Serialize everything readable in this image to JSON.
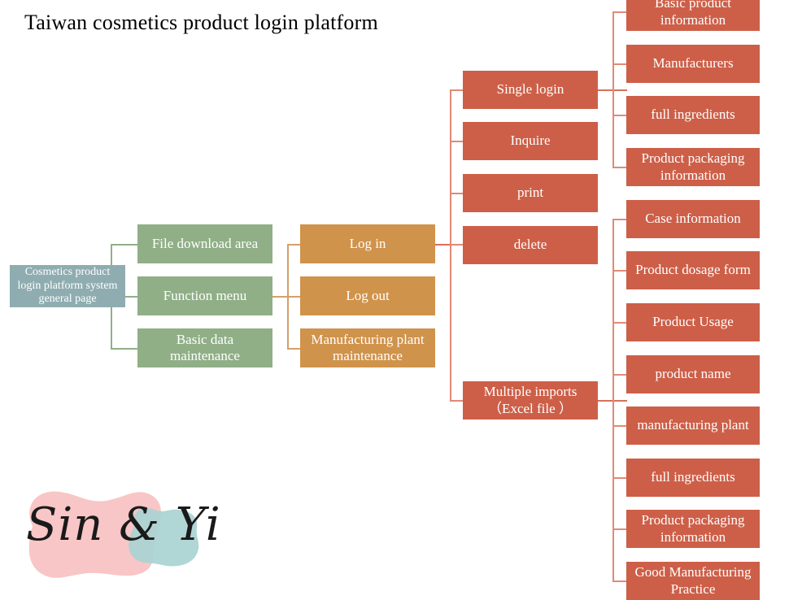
{
  "page": {
    "title": "Taiwan cosmetics product login platform",
    "background_color": "#ffffff"
  },
  "colors": {
    "root": "#8fadb0",
    "level1": "#90af87",
    "level2": "#d0934b",
    "level3": "#cd5f48",
    "connector_green": "#90af87",
    "connector_amber": "#d4a06a",
    "connector_red": "#e08a78",
    "text": "#ffffff",
    "title_text": "#000000",
    "logo_pink": "#f8c6c6",
    "logo_teal": "#a9d3d3"
  },
  "chart_data": {
    "type": "tree-diagram",
    "title": "Taiwan cosmetics product login platform",
    "root": "Cosmetics product  login platform system general page",
    "levels": [
      [
        "File download area",
        "Function menu",
        "Basic data maintenance"
      ],
      [
        "Log in",
        "Log out",
        "Manufacturing plant maintenance"
      ],
      [
        "Single login",
        "Inquire",
        "print",
        "delete",
        "Multiple imports （Excel file）"
      ],
      [
        "Basic product information",
        "Manufacturers",
        "full ingredients",
        "Product packaging information",
        "Case information",
        "Product dosage form",
        "Product Usage",
        "product name",
        "manufacturing plant",
        "full ingredients",
        "Product packaging information",
        "Good Manufacturing Practice"
      ]
    ],
    "edges": [
      {
        "from": "Cosmetics product  login platform system general page",
        "to": "File download area"
      },
      {
        "from": "Cosmetics product  login platform system general page",
        "to": "Function menu"
      },
      {
        "from": "Cosmetics product  login platform system general page",
        "to": "Basic data maintenance"
      },
      {
        "from": "Function menu",
        "to": "Log in"
      },
      {
        "from": "Function menu",
        "to": "Log out"
      },
      {
        "from": "Function menu",
        "to": "Manufacturing plant maintenance"
      },
      {
        "from": "Log in",
        "to": "Single login"
      },
      {
        "from": "Log in",
        "to": "Inquire"
      },
      {
        "from": "Log in",
        "to": "print"
      },
      {
        "from": "Log in",
        "to": "delete"
      },
      {
        "from": "Log in",
        "to": "Multiple imports （Excel file）"
      },
      {
        "from": "Single login",
        "to": "Basic product information"
      },
      {
        "from": "Single login",
        "to": "Manufacturers"
      },
      {
        "from": "Single login",
        "to": "full ingredients"
      },
      {
        "from": "Single login",
        "to": "Product packaging information"
      },
      {
        "from": "Multiple imports （Excel file）",
        "to": "Case information"
      },
      {
        "from": "Multiple imports （Excel file）",
        "to": "Product dosage form"
      },
      {
        "from": "Multiple imports （Excel file）",
        "to": "Product Usage"
      },
      {
        "from": "Multiple imports （Excel file）",
        "to": "product name"
      },
      {
        "from": "Multiple imports （Excel file）",
        "to": "manufacturing plant"
      },
      {
        "from": "Multiple imports （Excel file）",
        "to": "full ingredients"
      },
      {
        "from": "Multiple imports （Excel file）",
        "to": "Product packaging information"
      },
      {
        "from": "Multiple imports （Excel file）",
        "to": "Good Manufacturing Practice"
      }
    ]
  },
  "nodes": {
    "root": {
      "label": "Cosmetics product  login platform system general page"
    },
    "col1": [
      {
        "label": "File download area"
      },
      {
        "label": "Function menu"
      },
      {
        "label": "Basic data maintenance"
      }
    ],
    "col2": [
      {
        "label": "Log in"
      },
      {
        "label": "Log out"
      },
      {
        "label": "Manufacturing plant maintenance"
      }
    ],
    "col3": [
      {
        "label": "Single login"
      },
      {
        "label": "Inquire"
      },
      {
        "label": "print"
      },
      {
        "label": "delete"
      },
      {
        "label": "Multiple imports\n（Excel file）"
      }
    ],
    "col3_multi_line1": "Multiple imports",
    "col3_multi_line2": "（Excel file ）",
    "col4_top": [
      {
        "label": "Basic product information"
      },
      {
        "label": "Manufacturers"
      },
      {
        "label": "full ingredients"
      },
      {
        "label": "Product packaging information"
      }
    ],
    "col4_bottom": [
      {
        "label": "Case information"
      },
      {
        "label": "Product dosage form"
      },
      {
        "label": "Product Usage"
      },
      {
        "label": "product name"
      },
      {
        "label": "manufacturing plant"
      },
      {
        "label": "full ingredients"
      },
      {
        "label": "Product packaging information"
      },
      {
        "label": "Good Manufacturing Practice"
      }
    ]
  },
  "logo": {
    "text": "Sin & Yi"
  }
}
